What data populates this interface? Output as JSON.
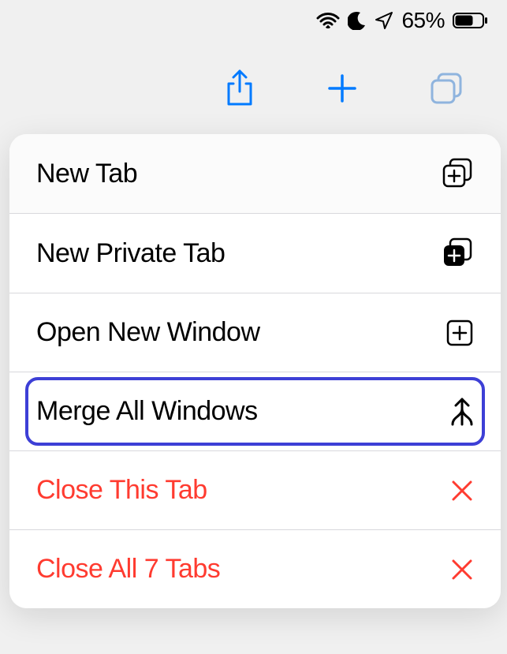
{
  "status": {
    "battery_pct": "65%"
  },
  "menu": {
    "items": [
      {
        "label": "New Tab",
        "icon": "new-tab-icon",
        "destructive": false
      },
      {
        "label": "New Private Tab",
        "icon": "new-private-tab-icon",
        "destructive": false
      },
      {
        "label": "Open New Window",
        "icon": "new-window-icon",
        "destructive": false
      },
      {
        "label": "Merge All Windows",
        "icon": "merge-icon",
        "destructive": false,
        "highlighted": true
      },
      {
        "label": "Close This Tab",
        "icon": "close-icon",
        "destructive": true
      },
      {
        "label": "Close All 7 Tabs",
        "icon": "close-icon",
        "destructive": true
      }
    ]
  }
}
